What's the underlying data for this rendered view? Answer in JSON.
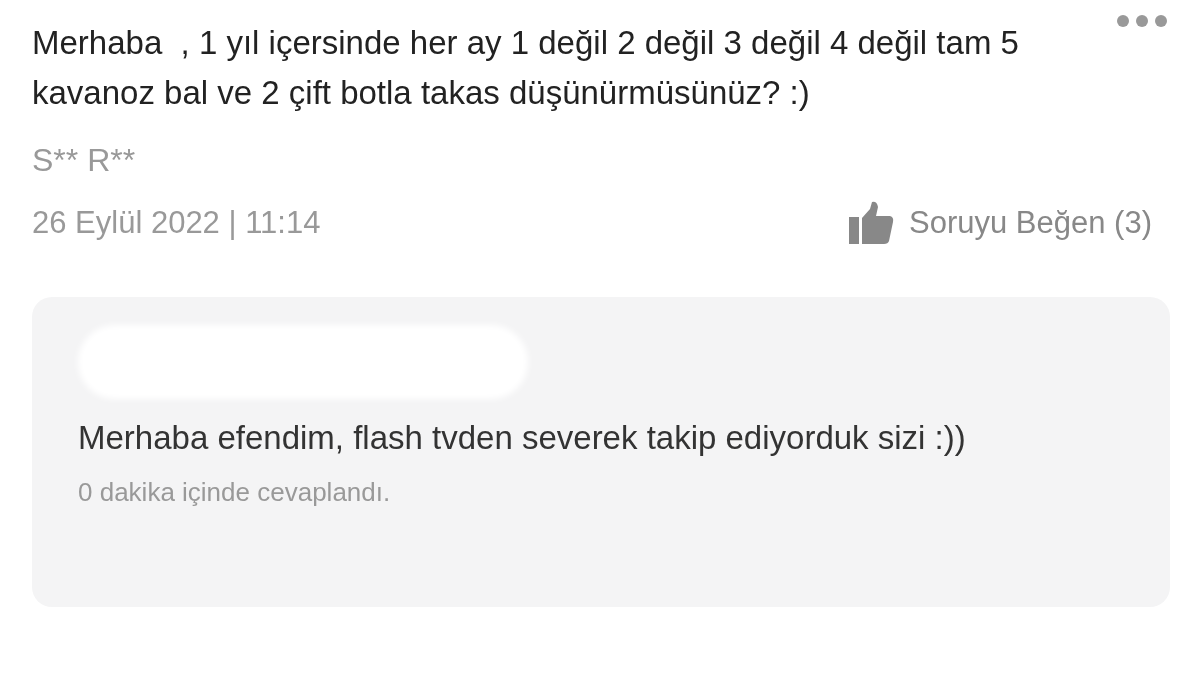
{
  "question": {
    "text": "Merhaba  , 1 yıl içersinde her ay 1 değil 2 değil 3 değil 4 değil tam 5 kavanoz bal ve 2 çift botla takas düşünürmüsünüz? :)",
    "author": "S** R**",
    "date": "26 Eylül 2022 | 11:14",
    "like_label": "Soruyu Beğen (3)"
  },
  "answer": {
    "text": "Merhaba efendim, flash tvden severek takip ediyorduk sizi :))",
    "meta": "0 dakika içinde cevaplandı."
  }
}
